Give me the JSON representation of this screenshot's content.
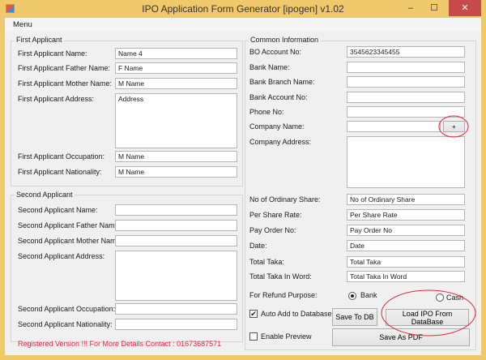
{
  "window": {
    "title": "IPO Application Form Generator [ipogen] v1.02",
    "minimize": "–",
    "maximize": "☐",
    "close": "✕"
  },
  "menu": {
    "label": "Menu"
  },
  "first": {
    "title": "First Applicant",
    "fields": [
      {
        "label": "First Applicant Name:",
        "value": "Name 4"
      },
      {
        "label": "First Applicant Father Name:",
        "value": "F Name"
      },
      {
        "label": "First Applicant Mother Name:",
        "value": "M Name"
      },
      {
        "label": "First Applicant Address:",
        "value": "Address"
      },
      {
        "label": "First Applicant Occupation:",
        "value": "M Name"
      },
      {
        "label": "First Applicant Nationality:",
        "value": "M Name"
      }
    ]
  },
  "second": {
    "title": "Second Applicant",
    "fields": [
      {
        "label": "Second Applicant Name:",
        "value": ""
      },
      {
        "label": "Second Applicant Father Name:",
        "value": ""
      },
      {
        "label": "Second Applicant Mother Name:",
        "value": ""
      },
      {
        "label": "Second Applicant Address:",
        "value": ""
      },
      {
        "label": "Second Applicant Occupation:",
        "value": ""
      },
      {
        "label": "Second Applicant Nationality:",
        "value": ""
      }
    ]
  },
  "common": {
    "title": "Common Information",
    "fields": [
      {
        "label": "BO Account No:",
        "value": "3545623345455"
      },
      {
        "label": "Bank Name:",
        "value": ""
      },
      {
        "label": "Bank Branch Name:",
        "value": ""
      },
      {
        "label": "Bank Account No:",
        "value": ""
      },
      {
        "label": "Phone No:",
        "value": ""
      },
      {
        "label": "Company Name:",
        "value": ""
      },
      {
        "label": "Company Address:",
        "value": ""
      },
      {
        "label": "No of Ordinary Share:",
        "value": "No of Ordinary Share"
      },
      {
        "label": "Per Share Rate:",
        "value": "Per Share Rate"
      },
      {
        "label": "Pay Order No:",
        "value": "Pay Order No"
      },
      {
        "label": "Date:",
        "value": "Date"
      },
      {
        "label": "Total Taka:",
        "value": "Total Taka"
      },
      {
        "label": "Total Taka In Word:",
        "value": "Total Taka In Word"
      }
    ],
    "add_company": "+",
    "refund": {
      "label": "For Refund Purpose:",
      "options": [
        "Bank",
        "Cash"
      ],
      "selected": "Bank"
    }
  },
  "actions": {
    "auto_add": {
      "label": "Auto Add to Database",
      "checked": true
    },
    "preview": {
      "label": "Enable Preview",
      "checked": false
    },
    "save_db": "Save To DB",
    "load_ipo": "Load IPO From DataBase",
    "save_pdf": "Save As PDF"
  },
  "footer": {
    "registered": "Registered Version !!! For More Details Contact : 01673687571"
  },
  "colors": {
    "frame": "#f0c96a",
    "annotation": "#e8243c",
    "registered_text": "#e8243c"
  }
}
